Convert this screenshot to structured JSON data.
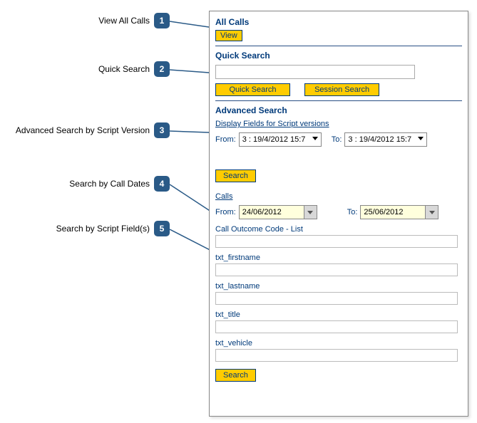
{
  "callouts": [
    {
      "num": "1",
      "label": "View All Calls"
    },
    {
      "num": "2",
      "label": "Quick Search"
    },
    {
      "num": "3",
      "label": "Advanced Search by Script Version"
    },
    {
      "num": "4",
      "label": "Search by Call Dates"
    },
    {
      "num": "5",
      "label": "Search by Script Field(s)"
    }
  ],
  "allCalls": {
    "title": "All Calls",
    "viewBtn": "View"
  },
  "quickSearch": {
    "title": "Quick Search",
    "value": "",
    "quickBtn": "Quick Search",
    "sessionBtn": "Session Search"
  },
  "advanced": {
    "title": "Advanced Search",
    "displayLink": "Display Fields for Script versions",
    "fromLbl": "From:",
    "toLbl": "To:",
    "fromVal": "3 : 19/4/2012 15:7",
    "toVal": "3 : 19/4/2012 15:7",
    "searchBtn": "Search"
  },
  "calls": {
    "link": "Calls",
    "fromLbl": "From:",
    "toLbl": "To:",
    "fromDate": "24/06/2012",
    "toDate": "25/06/2012"
  },
  "fields": [
    {
      "label": "Call Outcome Code - List",
      "value": ""
    },
    {
      "label": "txt_firstname",
      "value": ""
    },
    {
      "label": "txt_lastname",
      "value": ""
    },
    {
      "label": "txt_title",
      "value": ""
    },
    {
      "label": "txt_vehicle",
      "value": ""
    }
  ],
  "bottomSearchBtn": "Search"
}
